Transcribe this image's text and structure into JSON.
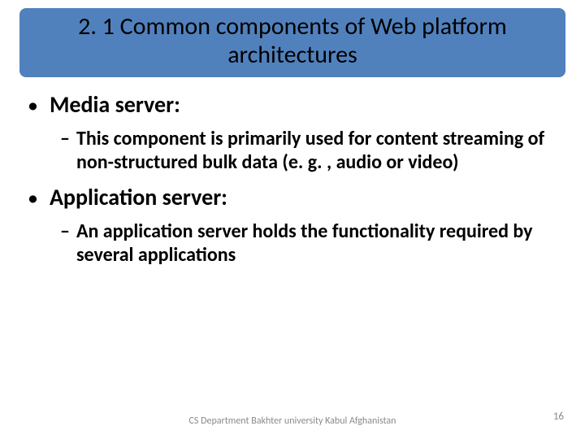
{
  "title": "2. 1 Common components of Web platform architectures",
  "items": [
    {
      "label": "Media server:",
      "sub": "This component is primarily used for content streaming of non-structured bulk data (e. g. , audio or video)"
    },
    {
      "label": "Application server:",
      "sub": "An application server holds the functionality required by several applications"
    }
  ],
  "footer": "CS Department Bakhter university Kabul Afghanistan",
  "page_number": "16"
}
